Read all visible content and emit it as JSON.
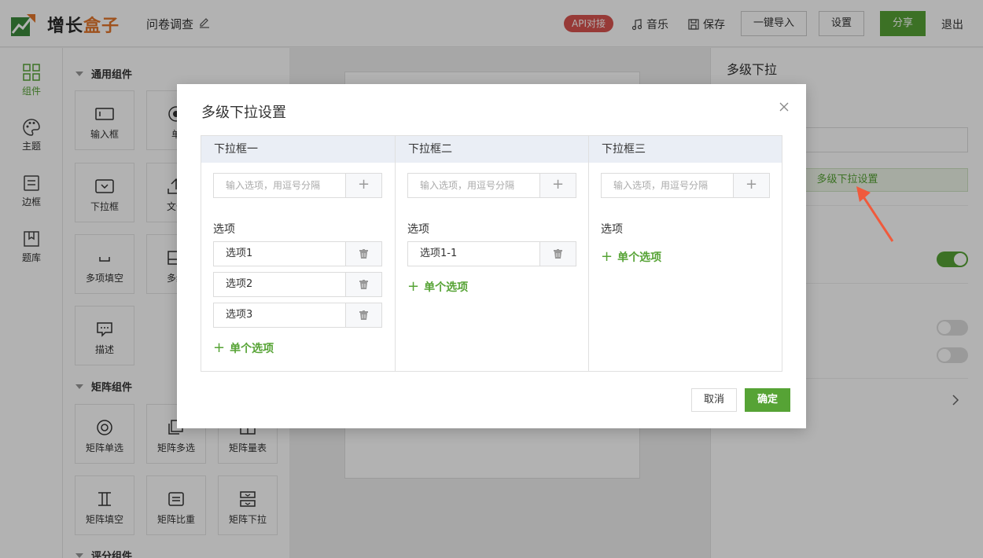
{
  "header": {
    "brand_part1": "增长",
    "brand_part2": "盒子",
    "doc_title": "问卷调查",
    "api_badge": "API对接",
    "music": "音乐",
    "save": "保存",
    "import": "一键导入",
    "settings": "设置",
    "share": "分享",
    "logout": "退出"
  },
  "rail": {
    "items": [
      {
        "label": "组件",
        "icon": "grid-icon"
      },
      {
        "label": "主题",
        "icon": "palette-icon"
      },
      {
        "label": "边框",
        "icon": "border-icon"
      },
      {
        "label": "题库",
        "icon": "bank-icon"
      }
    ]
  },
  "components": {
    "common_title": "通用组件",
    "matrix_title": "矩阵组件",
    "rating_title": "评分组件",
    "common": [
      {
        "label": "输入框",
        "icon": "input-icon"
      },
      {
        "label": "单",
        "icon": "radio-icon"
      },
      {
        "label": "下拉框",
        "icon": "dropdown-icon"
      },
      {
        "label": "文件",
        "icon": "upload-icon"
      },
      {
        "label": "多项填空",
        "icon": "blank-icon"
      },
      {
        "label": "多级",
        "icon": "multilevel-icon"
      },
      {
        "label": "描述",
        "icon": "comment-icon"
      }
    ],
    "matrix": [
      {
        "label": "矩阵单选",
        "icon": "matrix-radio-icon"
      },
      {
        "label": "矩阵多选",
        "icon": "matrix-checkbox-icon"
      },
      {
        "label": "矩阵量表",
        "icon": "matrix-scale-icon"
      },
      {
        "label": "矩阵填空",
        "icon": "matrix-blank-icon"
      },
      {
        "label": "矩阵比重",
        "icon": "matrix-weight-icon"
      },
      {
        "label": "矩阵下拉",
        "icon": "matrix-dropdown-icon"
      }
    ]
  },
  "right_panel": {
    "title": "多级下拉",
    "setting_button": "多级下拉设置"
  },
  "modal": {
    "title": "多级下拉设置",
    "input_placeholder": "输入选项，用逗号分隔",
    "options_label": "选项",
    "add_single": "单个选项",
    "cancel": "取消",
    "confirm": "确定",
    "columns": [
      {
        "header": "下拉框一",
        "options": [
          "选项1",
          "选项2",
          "选项3"
        ]
      },
      {
        "header": "下拉框二",
        "options": [
          "选项1-1"
        ]
      },
      {
        "header": "下拉框三",
        "options": []
      }
    ]
  },
  "colors": {
    "accent": "#56a335",
    "badge": "#d9534f",
    "brand_orange": "#e2762c"
  }
}
